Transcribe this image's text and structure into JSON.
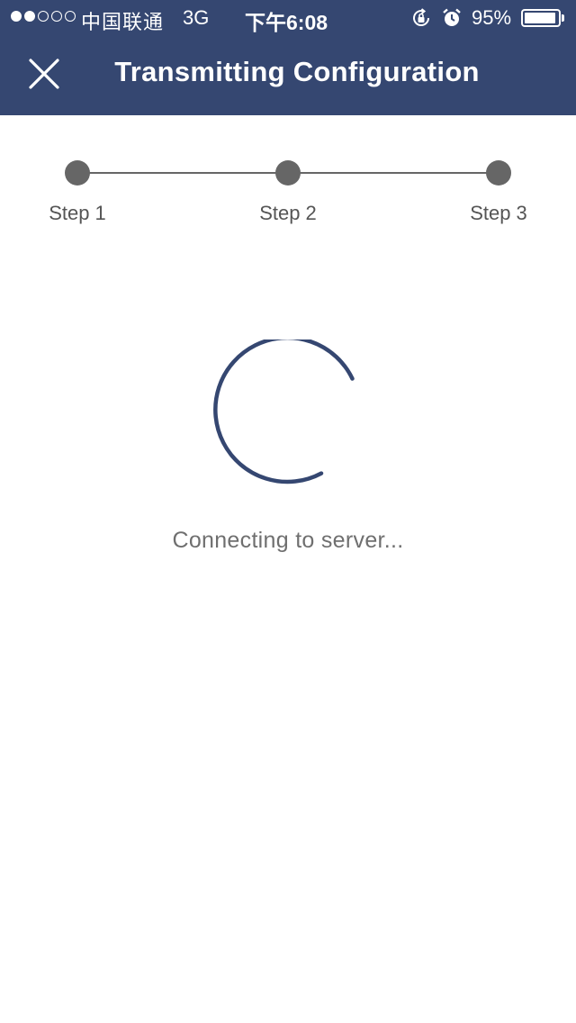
{
  "status_bar": {
    "signal_dots_filled": 2,
    "signal_dots_total": 5,
    "carrier": "中国联通",
    "network": "3G",
    "time": "下午6:08",
    "icons": [
      "orientation-lock-icon",
      "alarm-icon"
    ],
    "battery_percent_text": "95%",
    "battery_level": 0.95
  },
  "nav": {
    "close_icon": "close-icon",
    "title": "Transmitting Configuration"
  },
  "stepper": {
    "steps": [
      {
        "label": "Step 1"
      },
      {
        "label": "Step 2"
      },
      {
        "label": "Step 3"
      }
    ]
  },
  "progress": {
    "spinner_icon": "loading-spinner-icon",
    "message": "Connecting to server..."
  },
  "colors": {
    "header_bg": "#354771",
    "spinner": "#354771",
    "step_dot": "#666666",
    "text_muted": "#6f6f6f"
  }
}
